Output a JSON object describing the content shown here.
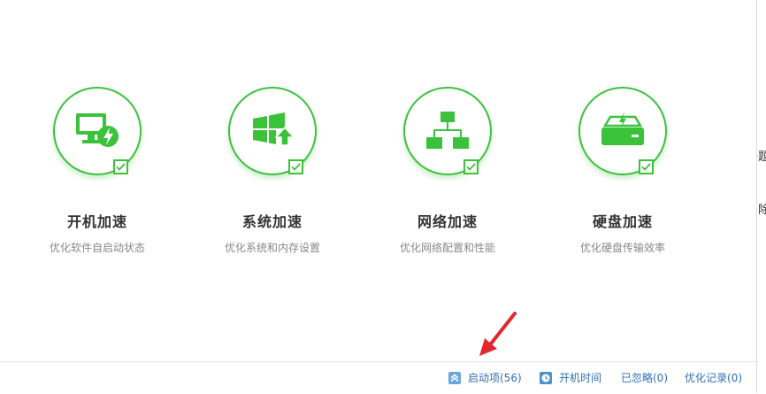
{
  "features": [
    {
      "title": "开机加速",
      "desc": "优化软件自启动状态",
      "icon": "monitor-bolt-icon"
    },
    {
      "title": "系统加速",
      "desc": "优化系统和内存设置",
      "icon": "windows-up-icon"
    },
    {
      "title": "网络加速",
      "desc": "优化网络配置和性能",
      "icon": "network-icon"
    },
    {
      "title": "硬盘加速",
      "desc": "优化硬盘传输效率",
      "icon": "harddisk-icon"
    }
  ],
  "bottombar": {
    "startup_items": "启动项(56)",
    "boot_time": "开机时间",
    "ignored": "已忽略(0)",
    "history": "优化记录(0)"
  },
  "right_strip_chars": [
    "题",
    "除"
  ],
  "colors": {
    "accent": "#3bc23b",
    "link": "#2f6fb5",
    "arrow": "#e0282e"
  }
}
